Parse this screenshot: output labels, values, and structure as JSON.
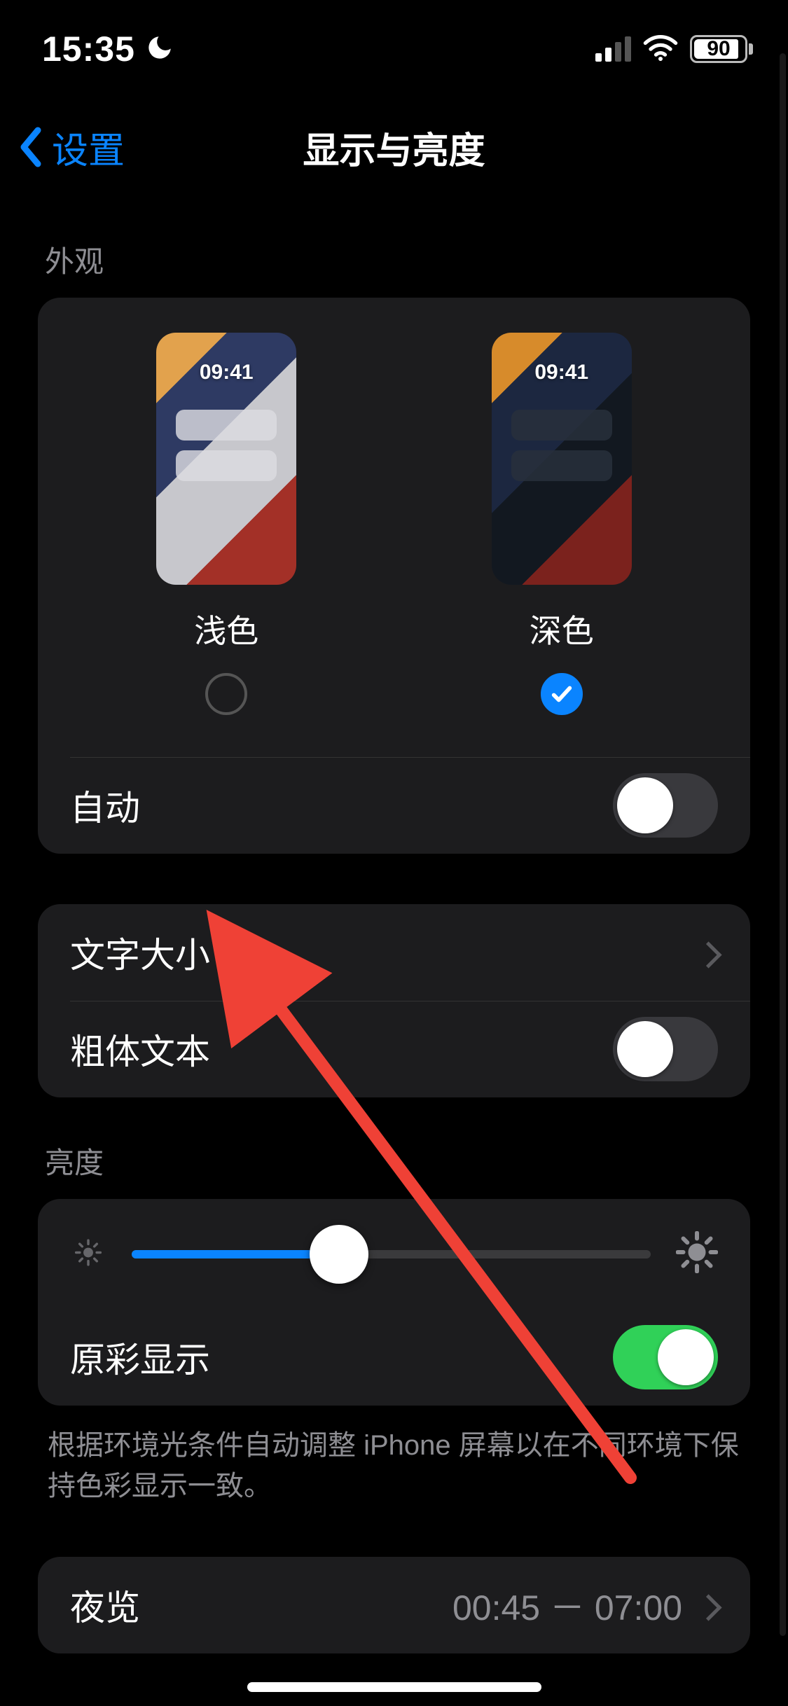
{
  "status": {
    "time": "15:35",
    "dnd_icon": "moon-icon",
    "battery_pct": "90",
    "battery_fill_pct": 90
  },
  "nav": {
    "back_label": "设置",
    "title": "显示与亮度"
  },
  "appearance": {
    "header": "外观",
    "preview_time": "09:41",
    "light": {
      "label": "浅色",
      "selected": false
    },
    "dark": {
      "label": "深色",
      "selected": true
    },
    "auto_label": "自动",
    "auto_on": false
  },
  "text_section": {
    "text_size_label": "文字大小",
    "bold_label": "粗体文本",
    "bold_on": false
  },
  "brightness": {
    "header": "亮度",
    "value_pct": 40,
    "true_tone_label": "原彩显示",
    "true_tone_on": true,
    "footer": "根据环境光条件自动调整 iPhone 屏幕以在不同环境下保持色彩显示一致。"
  },
  "night_shift": {
    "label": "夜览",
    "value": "00:45 － 07:00"
  }
}
